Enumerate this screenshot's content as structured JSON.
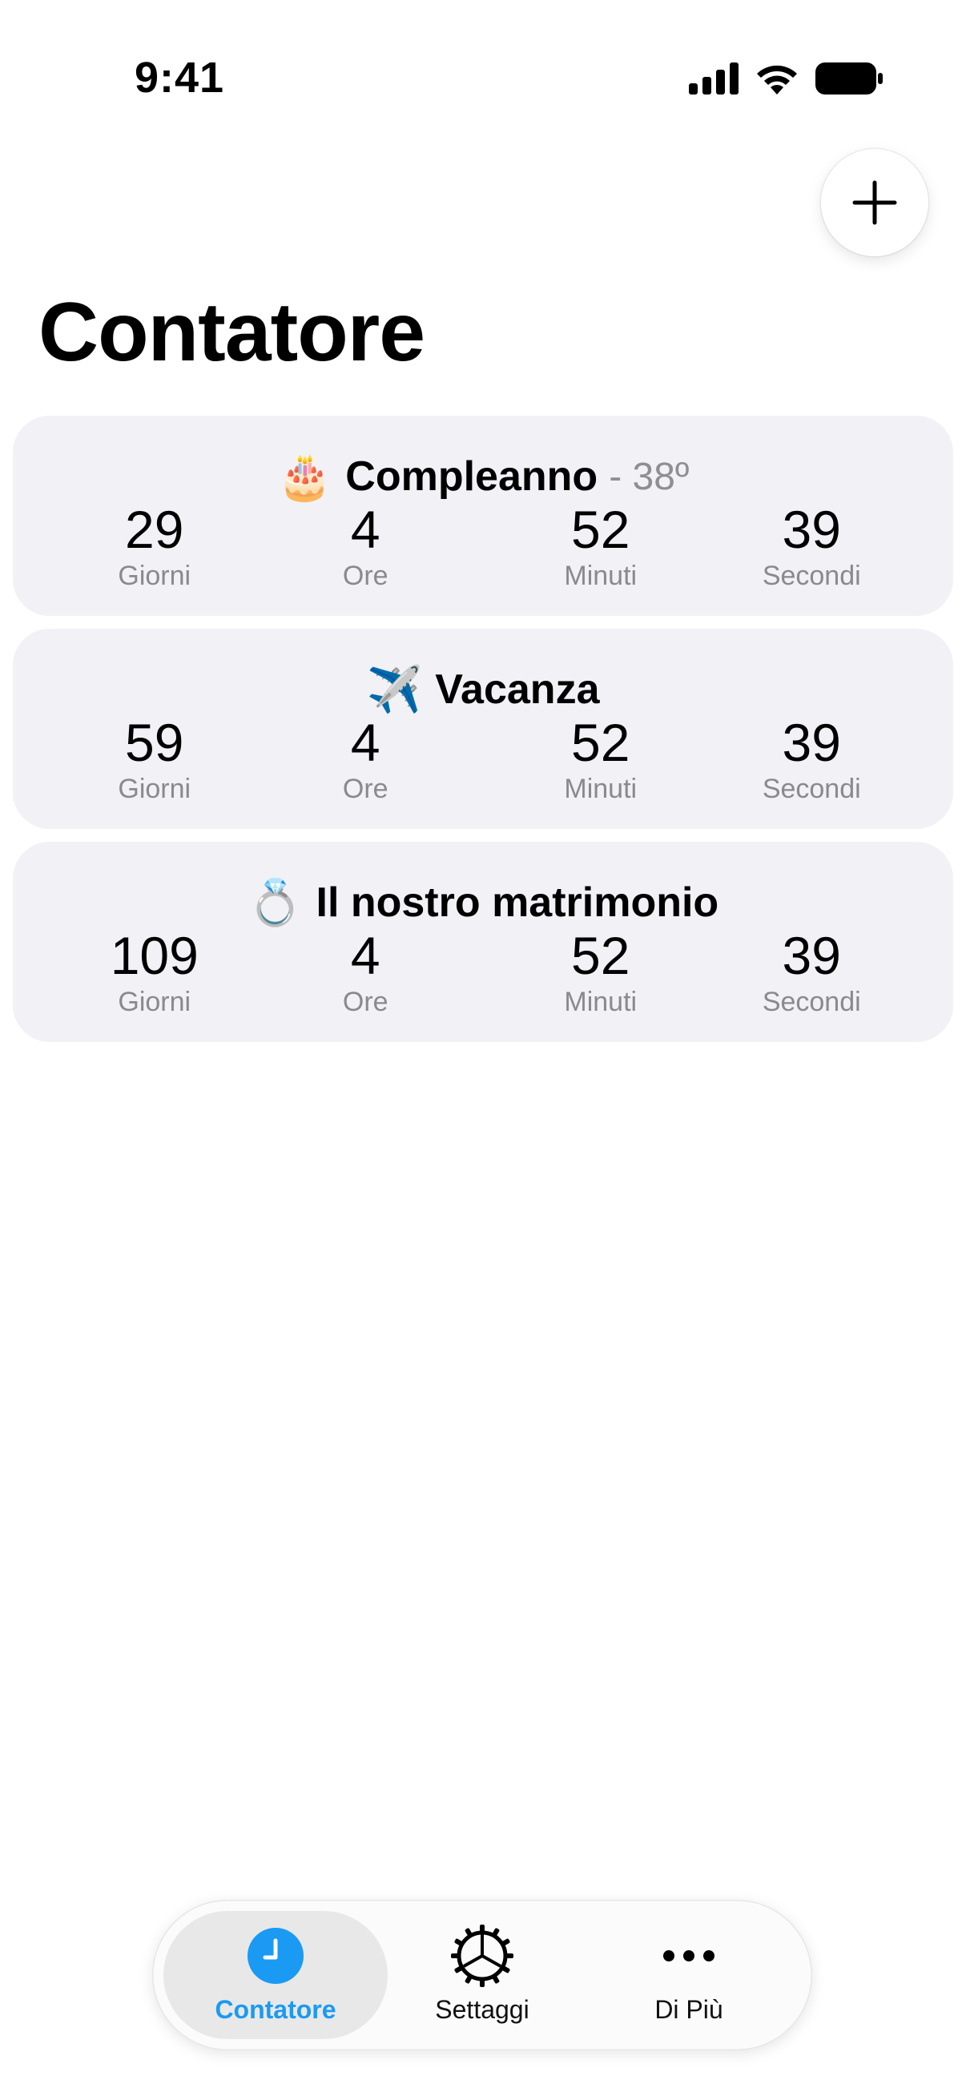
{
  "status_bar": {
    "time": "9:41"
  },
  "header": {
    "title": "Contatore",
    "add_icon": "plus-icon"
  },
  "counters": [
    {
      "emoji": "🎂",
      "title": "Compleanno",
      "suffix": "- 38º",
      "days": "29",
      "hours": "4",
      "minutes": "52",
      "seconds": "39"
    },
    {
      "emoji": "✈️",
      "title": "Vacanza",
      "suffix": "",
      "days": "59",
      "hours": "4",
      "minutes": "52",
      "seconds": "39"
    },
    {
      "emoji": "💍",
      "title": "Il nostro matrimonio",
      "suffix": "",
      "days": "109",
      "hours": "4",
      "minutes": "52",
      "seconds": "39"
    }
  ],
  "unit_labels": {
    "days": "Giorni",
    "hours": "Ore",
    "minutes": "Minuti",
    "seconds": "Secondi"
  },
  "tab_bar": {
    "tabs": [
      {
        "label": "Contatore",
        "icon": "clock-icon",
        "active": true
      },
      {
        "label": "Settaggi",
        "icon": "gear-icon",
        "active": false
      },
      {
        "label": "Di Più",
        "icon": "ellipsis-icon",
        "active": false
      }
    ]
  },
  "colors": {
    "accent": "#1a9af3",
    "card_background": "#f1f1f6",
    "secondary_text": "#8e8e93"
  }
}
